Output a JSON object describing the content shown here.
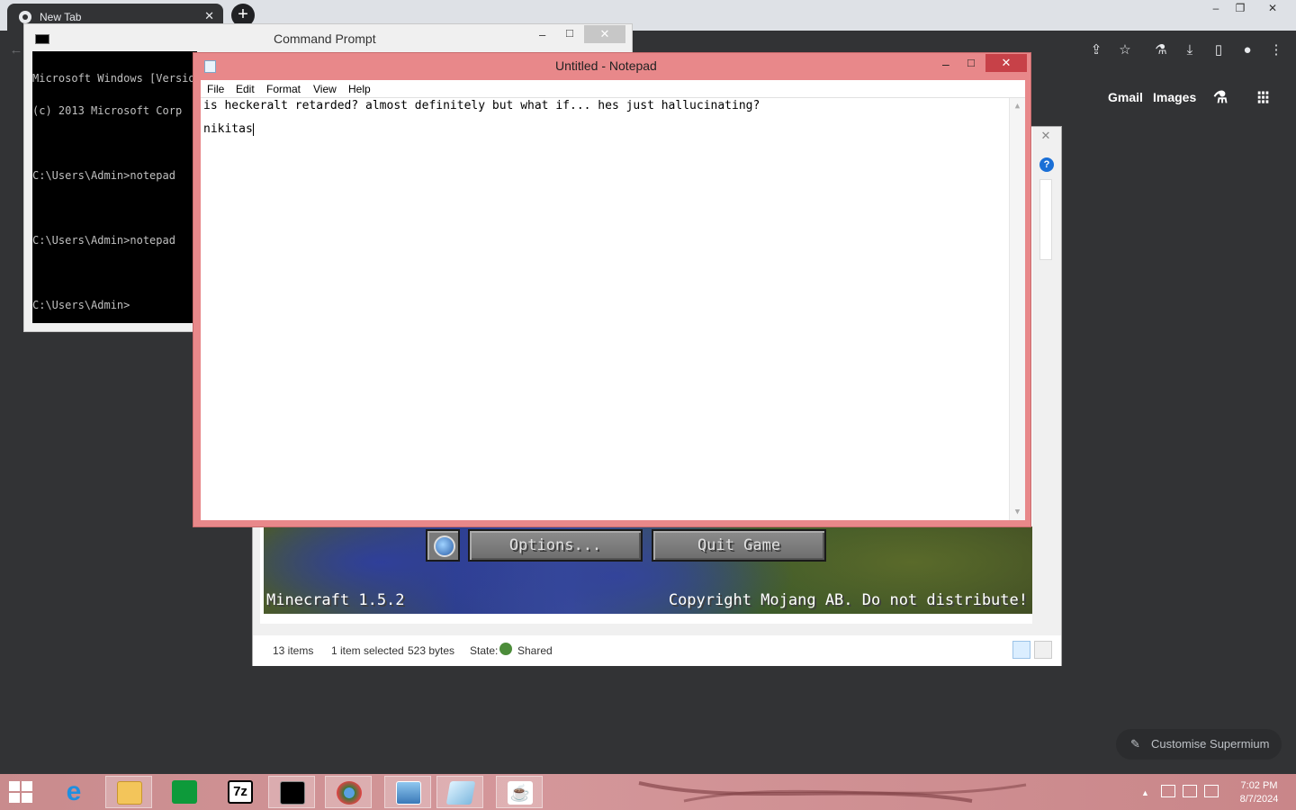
{
  "browser": {
    "tab_title": "New Tab",
    "tab_close": "✕",
    "new_tab": "+",
    "window_controls": {
      "minimize": "–",
      "restore": "❐",
      "close": "✕"
    },
    "toolbar_icons": [
      "share-icon",
      "star-icon",
      "labs-flask-icon",
      "download-icon",
      "sidepanel-icon",
      "profile-icon",
      "menu-kebab-icon"
    ],
    "ntp_links": {
      "gmail": "Gmail",
      "images": "Images"
    },
    "customise_label": "Customise Supermium"
  },
  "cmd": {
    "title": "Command Prompt",
    "lines": [
      "Microsoft Windows [Version",
      "(c) 2013 Microsoft Corp",
      "",
      "C:\\Users\\Admin>notepad",
      "",
      "C:\\Users\\Admin>notepad",
      "",
      "C:\\Users\\Admin>"
    ],
    "controls": {
      "minimize": "–",
      "maximize": "□",
      "close": "✕"
    }
  },
  "notepad": {
    "title": "Untitled - Notepad",
    "menu": [
      "File",
      "Edit",
      "Format",
      "View",
      "Help"
    ],
    "line1": "is heckeralt retarded? almost definitely but what if... hes just hallucinating?",
    "line2": "nikitas",
    "controls": {
      "minimize": "–",
      "maximize": "□",
      "close": "✕"
    },
    "scroll_up": "▲",
    "scroll_down": "▼"
  },
  "minecraft": {
    "options_label": "Options...",
    "quit_label": "Quit Game",
    "version": "Minecraft 1.5.2",
    "copyright": "Copyright Mojang AB. Do not distribute!"
  },
  "explorer": {
    "close": "✕",
    "help": "?",
    "items_count": "13 items",
    "selection": "1 item selected",
    "size": "523 bytes",
    "state_label": "State:",
    "state_value": "Shared"
  },
  "taskbar": {
    "apps": [
      "windows-start-icon",
      "internet-explorer-icon",
      "file-explorer-icon",
      "store-icon",
      "7zip-icon",
      "cmd-icon",
      "chrome-like-icon",
      "photo-viewer-icon",
      "notepad-icon",
      "java-icon"
    ],
    "tray": {
      "up_arrow": "▲"
    },
    "time": "7:02 PM",
    "date": "8/7/2024"
  },
  "colors": {
    "notepad_frame": "#e8888a",
    "taskbar": "#c98b8d",
    "browser_bg": "#323335"
  }
}
